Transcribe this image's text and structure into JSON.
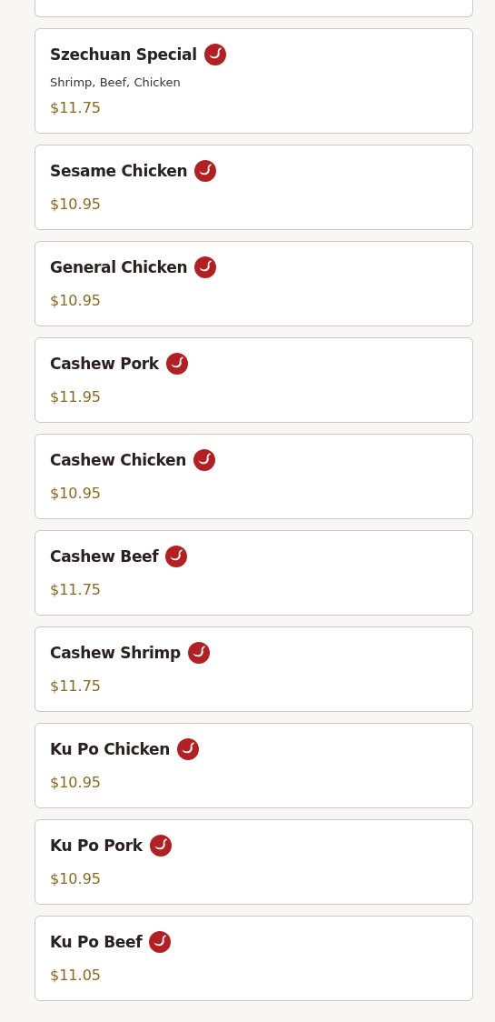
{
  "menu_items": [
    {
      "name": "Szechuan Special",
      "spicy": true,
      "description": "Shrimp, Beef, Chicken",
      "price": "$11.75"
    },
    {
      "name": "Sesame Chicken",
      "spicy": true,
      "price": "$10.95"
    },
    {
      "name": "General Chicken",
      "spicy": true,
      "price": "$10.95"
    },
    {
      "name": "Cashew Pork",
      "spicy": true,
      "price": "$11.95"
    },
    {
      "name": "Cashew Chicken",
      "spicy": true,
      "price": "$10.95"
    },
    {
      "name": "Cashew Beef",
      "spicy": true,
      "price": "$11.75"
    },
    {
      "name": "Cashew Shrimp",
      "spicy": true,
      "price": "$11.75"
    },
    {
      "name": "Ku Po Chicken",
      "spicy": true,
      "price": "$10.95"
    },
    {
      "name": "Ku Po Pork",
      "spicy": true,
      "price": "$10.95"
    },
    {
      "name": "Ku Po Beef",
      "spicy": true,
      "price": "$11.05"
    }
  ]
}
